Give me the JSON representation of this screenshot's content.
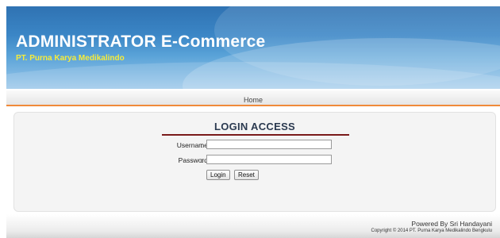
{
  "header": {
    "title": "ADMINISTRATOR E-Commerce",
    "subtitle": "PT. Purna Karya Medikalindo",
    "title_color": "#ffffff",
    "subtitle_color": "#f6ec3a",
    "background_color": "#3b86c6"
  },
  "nav": {
    "items": [
      {
        "label": "Home"
      }
    ],
    "underline_color": "#f08a3a"
  },
  "login": {
    "title": "LOGIN ACCESS",
    "title_rule_color": "#7a1a1a",
    "username_label": "Username",
    "username_colon": ":",
    "username_value": "",
    "password_label": "Password",
    "password_colon": ":",
    "password_value": "",
    "login_button": "Login",
    "reset_button": "Reset"
  },
  "footer": {
    "powered_by": "Powered By Sri Handayani",
    "copyright": "Copyright © 2014 PT. Purna Karya Medikalindo Bengkulu"
  }
}
